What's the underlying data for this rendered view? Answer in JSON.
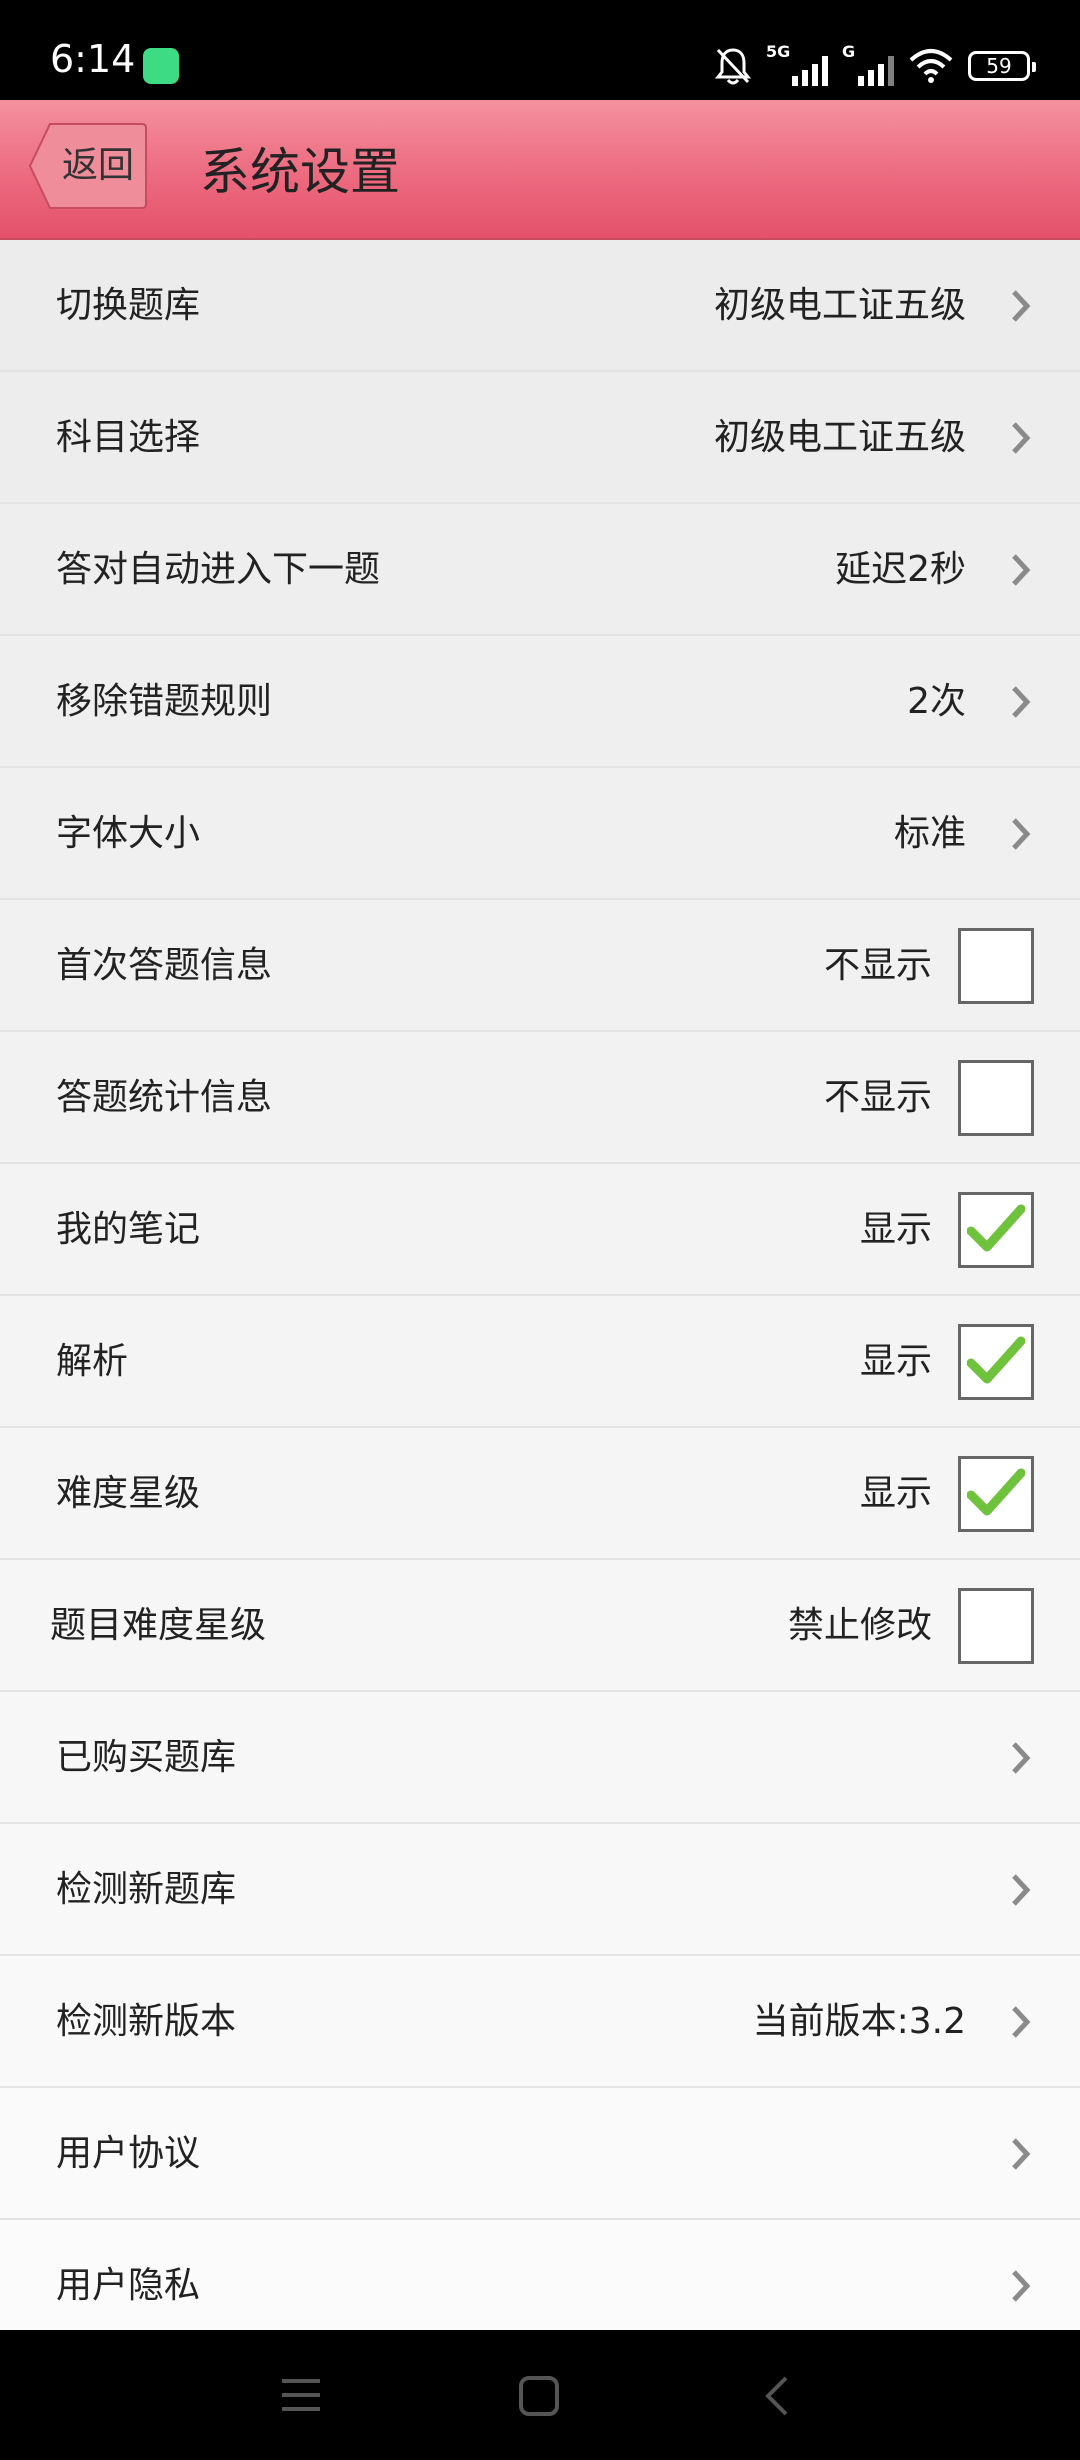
{
  "status_bar": {
    "time": "6:14",
    "signal1_label": "5G",
    "signal2_label": "G",
    "battery": "59",
    "icons": [
      "android-icon",
      "bell-off-icon",
      "signal-icon",
      "wifi-icon",
      "battery-icon"
    ]
  },
  "header": {
    "back_label": "返回",
    "title": "系统设置",
    "colors": {
      "accent": "#ec6a7f",
      "accent_light": "#f4919f",
      "accent_dark": "#e4516a"
    }
  },
  "settings": [
    {
      "label": "切换题库",
      "value": "初级电工证五级",
      "control": "chevron"
    },
    {
      "label": "科目选择",
      "value": "初级电工证五级",
      "control": "chevron"
    },
    {
      "label": "答对自动进入下一题",
      "value": "延迟2秒",
      "control": "chevron"
    },
    {
      "label": "移除错题规则",
      "value": "2次",
      "control": "chevron"
    },
    {
      "label": "字体大小",
      "value": "标准",
      "control": "chevron"
    },
    {
      "label": "首次答题信息",
      "value": "不显示",
      "control": "checkbox",
      "checked": false
    },
    {
      "label": "答题统计信息",
      "value": "不显示",
      "control": "checkbox",
      "checked": false
    },
    {
      "label": "我的笔记",
      "value": "显示",
      "control": "checkbox",
      "checked": true
    },
    {
      "label": "解析",
      "value": "显示",
      "control": "checkbox",
      "checked": true
    },
    {
      "label": "难度星级",
      "value": "显示",
      "control": "checkbox",
      "checked": true
    },
    {
      "label": "题目难度星级",
      "value": "禁止修改",
      "control": "checkbox",
      "checked": false
    },
    {
      "label": "已购买题库",
      "value": "",
      "control": "chevron"
    },
    {
      "label": "检测新题库",
      "value": "",
      "control": "chevron"
    },
    {
      "label": "检测新版本",
      "value": "当前版本:3.2",
      "control": "chevron"
    },
    {
      "label": "用户协议",
      "value": "",
      "control": "chevron"
    },
    {
      "label": "用户隐私",
      "value": "",
      "control": "chevron"
    }
  ],
  "nav_bar": {
    "icons": [
      "menu-icon",
      "home-icon",
      "back-icon"
    ]
  }
}
